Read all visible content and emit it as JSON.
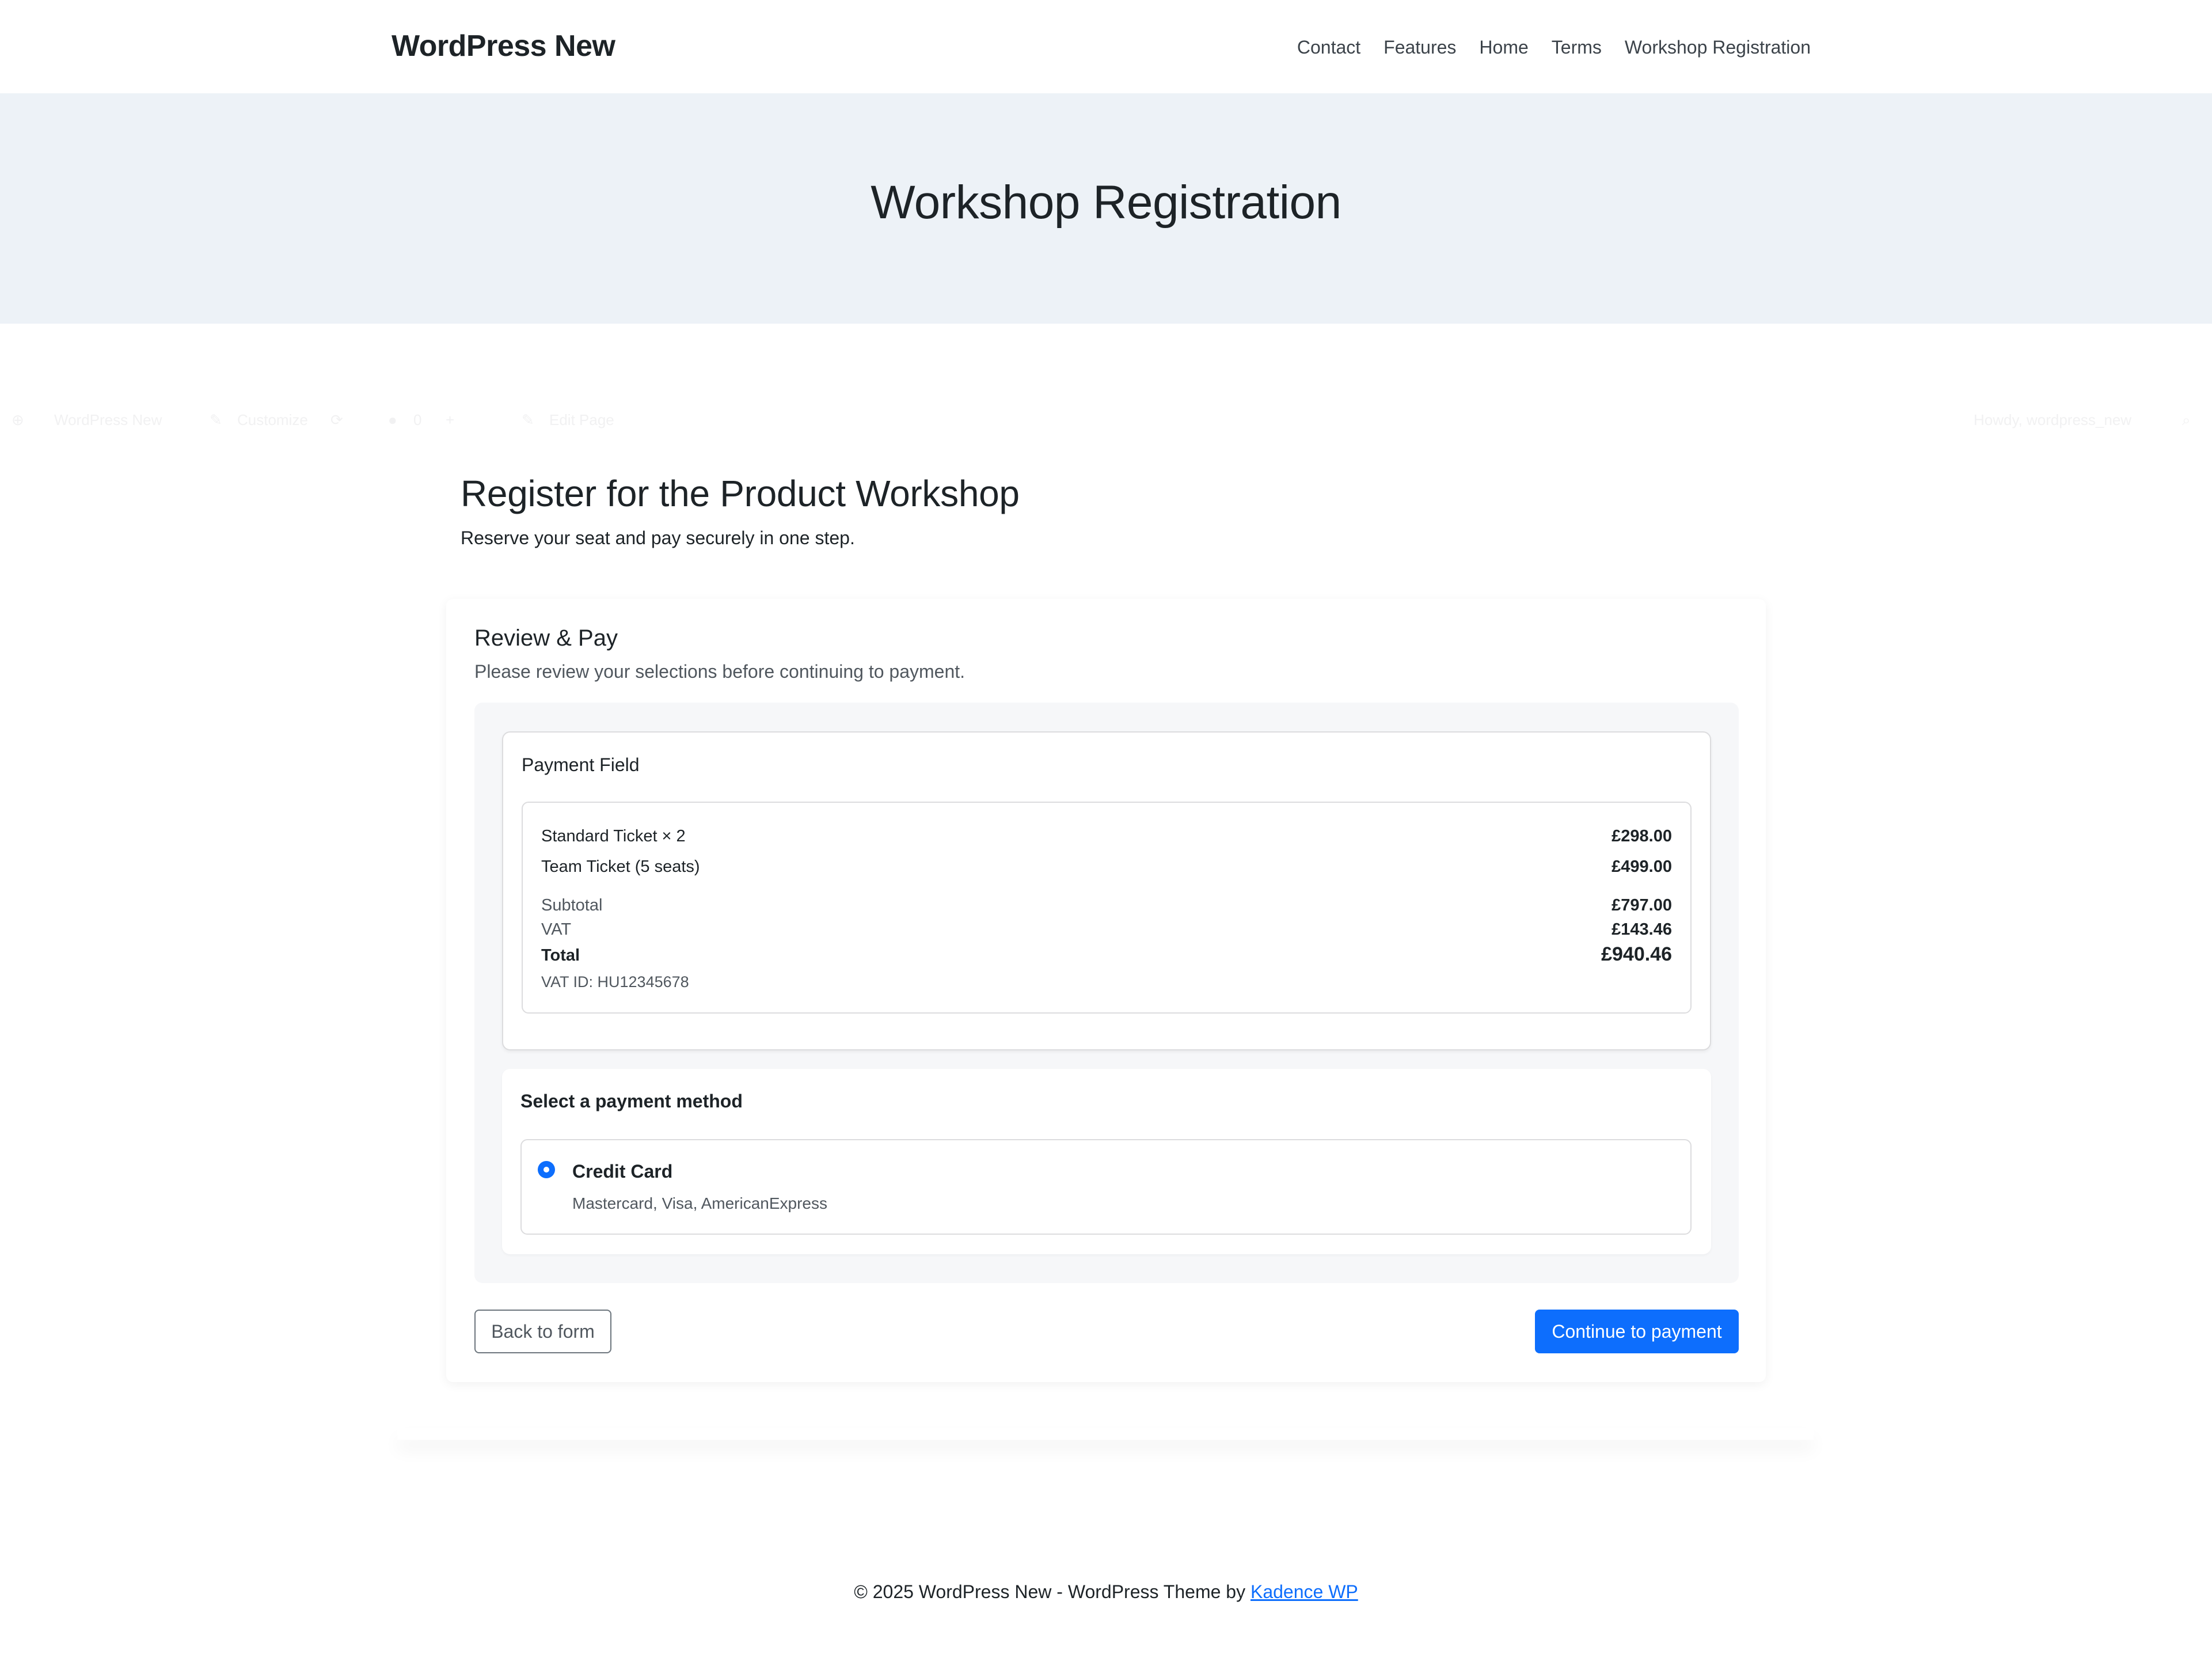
{
  "header": {
    "site_title": "WordPress New",
    "nav": [
      "Contact",
      "Features",
      "Home",
      "Terms",
      "Workshop Registration"
    ]
  },
  "hero": {
    "title": "Workshop Registration"
  },
  "admin_bar": {
    "site": "WordPress New",
    "customize": "Customize",
    "comments": "0",
    "edit": "Edit Page",
    "howdy": "Howdy, wordpress_new"
  },
  "main": {
    "heading": "Register for the Product Workshop",
    "subheading": "Reserve your seat and pay securely in one step."
  },
  "review": {
    "title": "Review & Pay",
    "subtitle": "Please review your selections before continuing to payment."
  },
  "payment_field": {
    "label": "Payment Field",
    "items": [
      {
        "label": "Standard Ticket × 2",
        "amount": "£298.00"
      },
      {
        "label": "Team Ticket (5 seats)",
        "amount": "£499.00"
      }
    ],
    "subtotal": {
      "label": "Subtotal",
      "amount": "£797.00"
    },
    "vat": {
      "label": "VAT",
      "amount": "£143.46"
    },
    "total": {
      "label": "Total",
      "amount": "£940.46"
    },
    "vat_id": "VAT ID: HU12345678"
  },
  "payment_method": {
    "title": "Select a payment method",
    "option": {
      "name": "Credit Card",
      "description": "Mastercard, Visa, AmericanExpress",
      "selected": true
    }
  },
  "actions": {
    "back": "Back to form",
    "continue": "Continue to payment"
  },
  "footer": {
    "text": "© 2025 WordPress New - WordPress Theme by ",
    "link": "Kadence WP"
  },
  "colors": {
    "accent": "#0d6efd",
    "hero_bg": "#edf2f7",
    "panel_bg": "#f6f7f9"
  }
}
